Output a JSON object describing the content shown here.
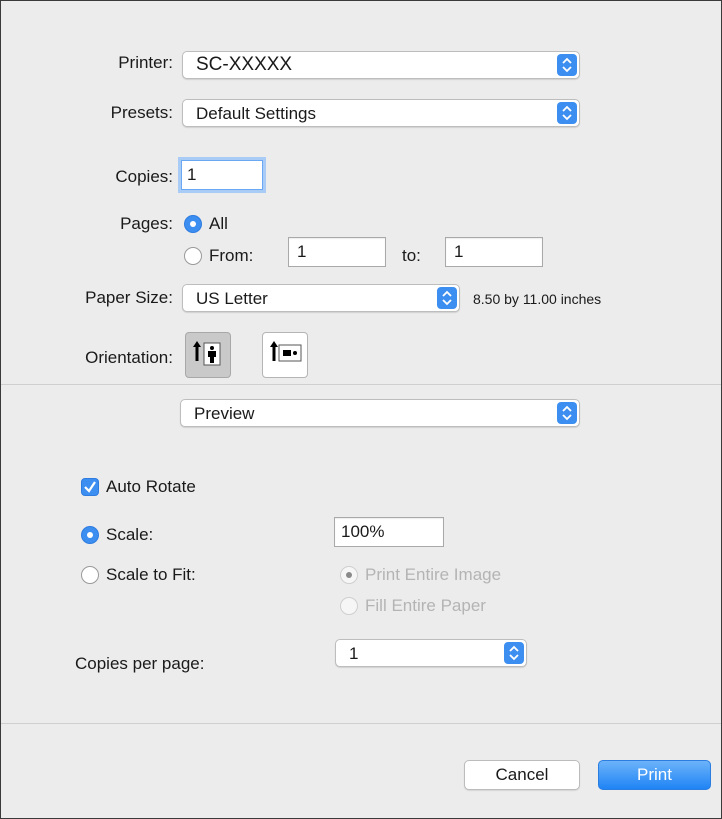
{
  "printer": {
    "label": "Printer:",
    "value": "SC-XXXXX"
  },
  "presets": {
    "label": "Presets:",
    "value": "Default Settings"
  },
  "copies": {
    "label": "Copies:",
    "value": "1"
  },
  "pages": {
    "label": "Pages:",
    "all_label": "All",
    "from_label": "From:",
    "from_value": "1",
    "to_label": "to:",
    "to_value": "1",
    "selected": "All"
  },
  "paper_size": {
    "label": "Paper Size:",
    "value": "US Letter",
    "dimensions": "8.50 by 11.00 inches"
  },
  "orientation": {
    "label": "Orientation:",
    "selected": "portrait",
    "icons": [
      "portrait-orientation-icon",
      "landscape-orientation-icon"
    ]
  },
  "app_section": {
    "value": "Preview"
  },
  "auto_rotate": {
    "label": "Auto Rotate",
    "checked": true
  },
  "scale": {
    "label": "Scale:",
    "value": "100%",
    "selected": true
  },
  "scale_to_fit": {
    "label": "Scale to Fit:",
    "print_entire_image": "Print Entire Image",
    "fill_entire_paper": "Fill Entire Paper"
  },
  "copies_per_page": {
    "label": "Copies per page:",
    "value": "1"
  },
  "buttons": {
    "cancel": "Cancel",
    "print": "Print"
  },
  "colors": {
    "accent": "#3d8ef1",
    "window_bg": "#ececec"
  }
}
